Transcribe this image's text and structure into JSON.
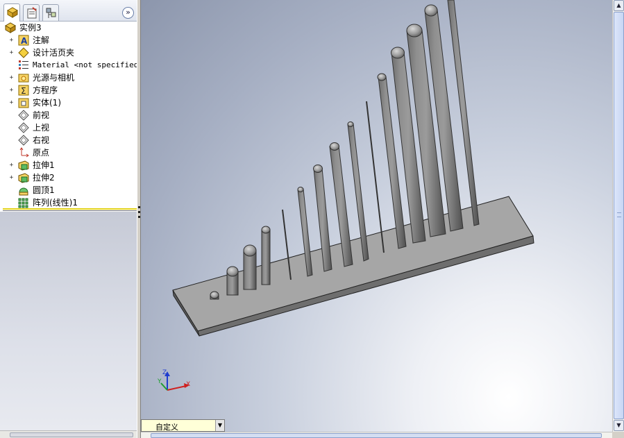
{
  "feature_tree": {
    "root": {
      "label": "实例3",
      "icon": "part-icon"
    },
    "items": [
      {
        "label": "注解",
        "icon": "annotations-icon",
        "expandable": true
      },
      {
        "label": "设计活页夹",
        "icon": "design-binder-icon",
        "expandable": true
      },
      {
        "label": "Material <not specified>",
        "icon": "material-icon",
        "expandable": false
      },
      {
        "label": "光源与相机",
        "icon": "lights-cameras-icon",
        "expandable": true
      },
      {
        "label": "方程序",
        "icon": "equations-icon",
        "expandable": true
      },
      {
        "label": "实体(1)",
        "icon": "solid-bodies-icon",
        "expandable": true
      },
      {
        "label": "前视",
        "icon": "plane-icon",
        "expandable": false
      },
      {
        "label": "上视",
        "icon": "plane-icon",
        "expandable": false
      },
      {
        "label": "右视",
        "icon": "plane-icon",
        "expandable": false
      },
      {
        "label": "原点",
        "icon": "origin-icon",
        "expandable": false
      },
      {
        "label": "拉伸1",
        "icon": "extrude-icon",
        "expandable": true
      },
      {
        "label": "拉伸2",
        "icon": "extrude-icon",
        "expandable": true
      },
      {
        "label": "圆顶1",
        "icon": "dome-icon",
        "expandable": false
      },
      {
        "label": "阵列(线性)1",
        "icon": "linear-pattern-icon",
        "expandable": false
      }
    ]
  },
  "tabs": [
    {
      "name": "feature-manager-tab",
      "icon": "feature-manager-icon"
    },
    {
      "name": "property-manager-tab",
      "icon": "property-manager-icon"
    },
    {
      "name": "configuration-manager-tab",
      "icon": "configuration-manager-icon"
    }
  ],
  "view_orientation": {
    "selected": "自定义"
  },
  "triad": {
    "x": "X",
    "y": "Y",
    "z": "Z"
  },
  "colors": {
    "rollback_bar": "#e3d21a",
    "model_gray": "#8c8c8c",
    "tree_background": "#ffffff"
  }
}
